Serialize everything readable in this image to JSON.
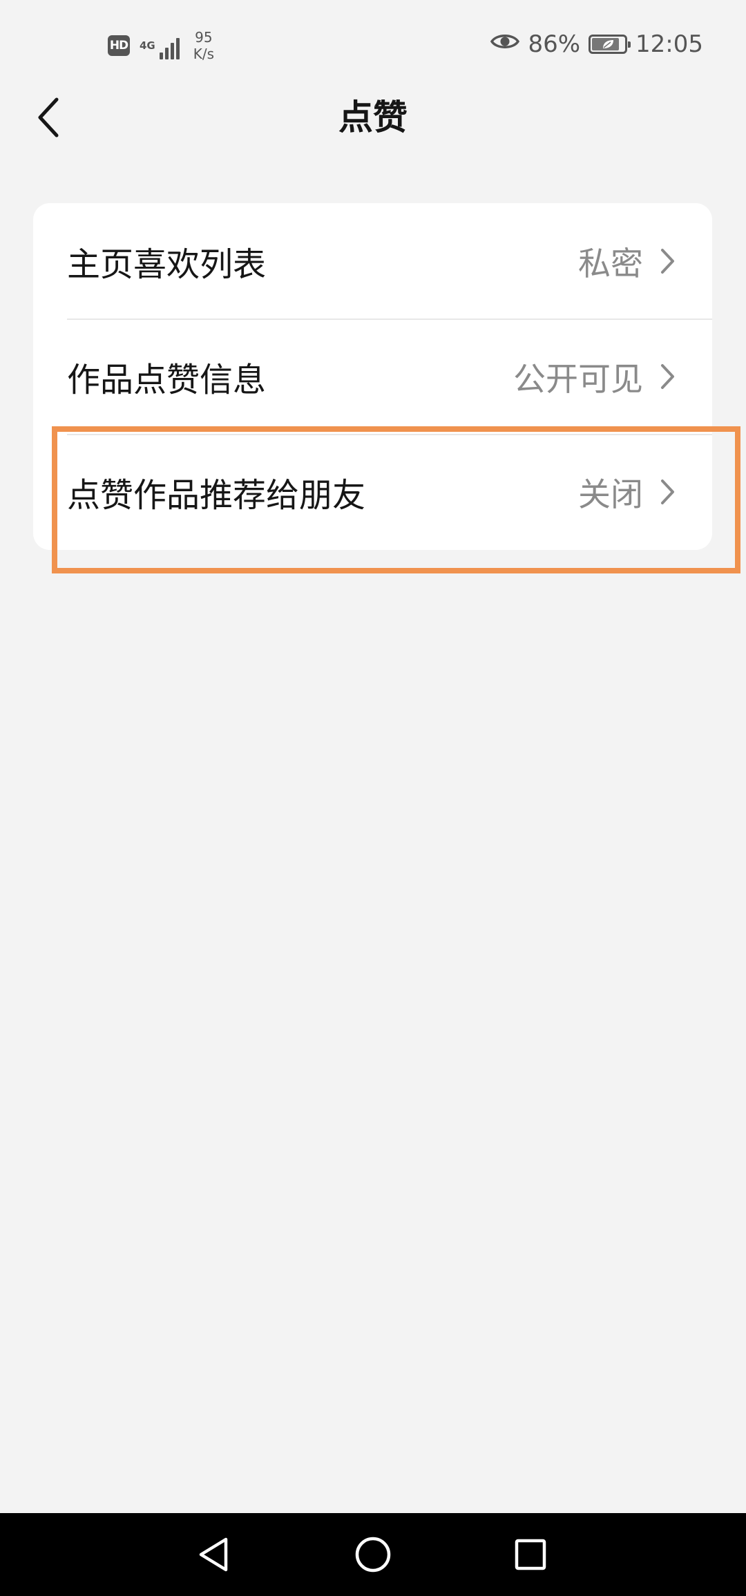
{
  "status_bar": {
    "hd": "HD",
    "network_type": "4G",
    "speed_value": "95",
    "speed_unit": "K/s",
    "battery_percent": "86%",
    "battery_level": 0.86,
    "time": "12:05",
    "icons": [
      "signal-icon",
      "eye-icon",
      "battery-icon"
    ]
  },
  "header": {
    "title": "点赞",
    "back_icon": "chevron-left-icon"
  },
  "settings": {
    "items": [
      {
        "label": "主页喜欢列表",
        "value": "私密"
      },
      {
        "label": "作品点赞信息",
        "value": "公开可见"
      },
      {
        "label": "点赞作品推荐给朋友",
        "value": "关闭"
      }
    ]
  },
  "colors": {
    "background": "#f3f3f3",
    "card": "#ffffff",
    "highlight": "#f0924e",
    "value_text": "#8a8a8a"
  },
  "nav_bar": {
    "icons": [
      "back-triangle-icon",
      "home-circle-icon",
      "recent-square-icon"
    ]
  }
}
